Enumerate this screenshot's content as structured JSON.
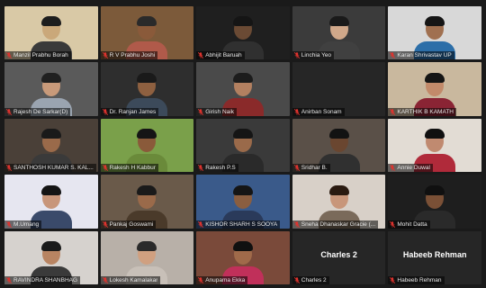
{
  "meeting": {
    "participants": [
      {
        "name": "Manzil Prabhu Borah",
        "tone": "#caa87a",
        "shirt": "#3a3a3a",
        "bg": "#d9c9a6",
        "hair": "#1d1d1d"
      },
      {
        "name": "R V Prabhu Joshi",
        "tone": "#8a5a3a",
        "shirt": "#b05a4a",
        "bg": "#7c5a3a",
        "hair": "#2a2a2a"
      },
      {
        "name": "Abhijit Baruah",
        "tone": "#6a4a34",
        "shirt": "#303030",
        "bg": "#1f1f1f",
        "hair": "#151515"
      },
      {
        "name": "Linchia Yeo",
        "tone": "#d0a88a",
        "shirt": "#404040",
        "bg": "#3b3b3b",
        "hair": "#1a1a1a"
      },
      {
        "name": "Karan Shrivastav UP",
        "tone": "#a07050",
        "shirt": "#2c6ea8",
        "bg": "#d8d8d8",
        "hair": "#151515"
      },
      {
        "name": "Rajesh De Sarkar(D)",
        "tone": "#c89a7a",
        "shirt": "#9aa4b0",
        "bg": "#5a5a5a",
        "hair": "#202020"
      },
      {
        "name": "Dr. Ranjan James",
        "tone": "#8e6040",
        "shirt": "#3c4a5a",
        "bg": "#2e2e2e",
        "hair": "#1a1a1a"
      },
      {
        "name": "Girish Naik",
        "tone": "#b38060",
        "shirt": "#8a2a2a",
        "bg": "#4a4a4a",
        "hair": "#1c1c1c"
      },
      {
        "name": "Anirban Sonam",
        "tone": "",
        "shirt": "",
        "bg": "#262626",
        "hair": ""
      },
      {
        "name": "KARTHIK B KAMATH",
        "tone": "#c28a6a",
        "shirt": "#8a2434",
        "bg": "#c9b89e",
        "hair": "#151515"
      },
      {
        "name": "SANTHOSH KUMAR S. KAL...",
        "tone": "#9a6a4a",
        "shirt": "#3a3a3a",
        "bg": "#4a4038",
        "hair": "#1a1a1a"
      },
      {
        "name": "Rakesh H Kabbur",
        "tone": "#8a5a3a",
        "shirt": "#6a8a3a",
        "bg": "#7aa04a",
        "hair": "#151515"
      },
      {
        "name": "Rakesh P.S",
        "tone": "#9a6a4a",
        "shirt": "#2a2a2a",
        "bg": "#3a3a3a",
        "hair": "#151515"
      },
      {
        "name": "Sridhar B.",
        "tone": "#6a4630",
        "shirt": "#303030",
        "bg": "#5a5048",
        "hair": "#121212"
      },
      {
        "name": "Annie Duwal",
        "tone": "#c08a70",
        "shirt": "#b02a3a",
        "bg": "#e2dcd4",
        "hair": "#101010"
      },
      {
        "name": "M.Umang",
        "tone": "#c8967a",
        "shirt": "#3a4a6a",
        "bg": "#e6e6f0",
        "hair": "#141414"
      },
      {
        "name": "Pankaj Goswami",
        "tone": "#9a6a4a",
        "shirt": "#4a3a2a",
        "bg": "#6a5a4a",
        "hair": "#1a1a1a"
      },
      {
        "name": "KISHOR SHARH S SOOYA",
        "tone": "#8a5e40",
        "shirt": "#2a3a5a",
        "bg": "#3a5a8a",
        "hair": "#151515"
      },
      {
        "name": "Sneha Dhanaskar Gracie (...",
        "tone": "#c8967a",
        "shirt": "#7a6a5a",
        "bg": "#d8d0c8",
        "hair": "#2a1a10"
      },
      {
        "name": "Mohit Datta",
        "tone": "#7a5036",
        "shirt": "#2a2a2a",
        "bg": "#1e1e1e",
        "hair": "#101010"
      },
      {
        "name": "RAVINDRA SHANBHAG",
        "tone": "#b88462",
        "shirt": "#3a3a3a",
        "bg": "#d6d2ce",
        "hair": "#1a1a1a"
      },
      {
        "name": "Lokesh Kamalakar",
        "tone": "#d0a080",
        "shirt": "#c8c0b8",
        "bg": "#b8b0a8",
        "hair": "#2a2a2a"
      },
      {
        "name": "Anupama Ekka",
        "tone": "#a06a4a",
        "shirt": "#c0305a",
        "bg": "#7a4a3a",
        "hair": "#101010"
      },
      {
        "name": "Charles 2",
        "display": "Charles 2",
        "tone": "",
        "shirt": "",
        "bg": "#262626",
        "hair": ""
      },
      {
        "name": "Habeeb Rehman",
        "display": "Habeeb Rehman",
        "tone": "",
        "shirt": "",
        "bg": "#262626",
        "hair": ""
      }
    ]
  },
  "colors": {
    "mute_icon": "#e0332e",
    "tile_bg": "#262626",
    "page_bg": "#1a1a1a"
  },
  "icons": {
    "muted": "microphone-muted-icon"
  }
}
